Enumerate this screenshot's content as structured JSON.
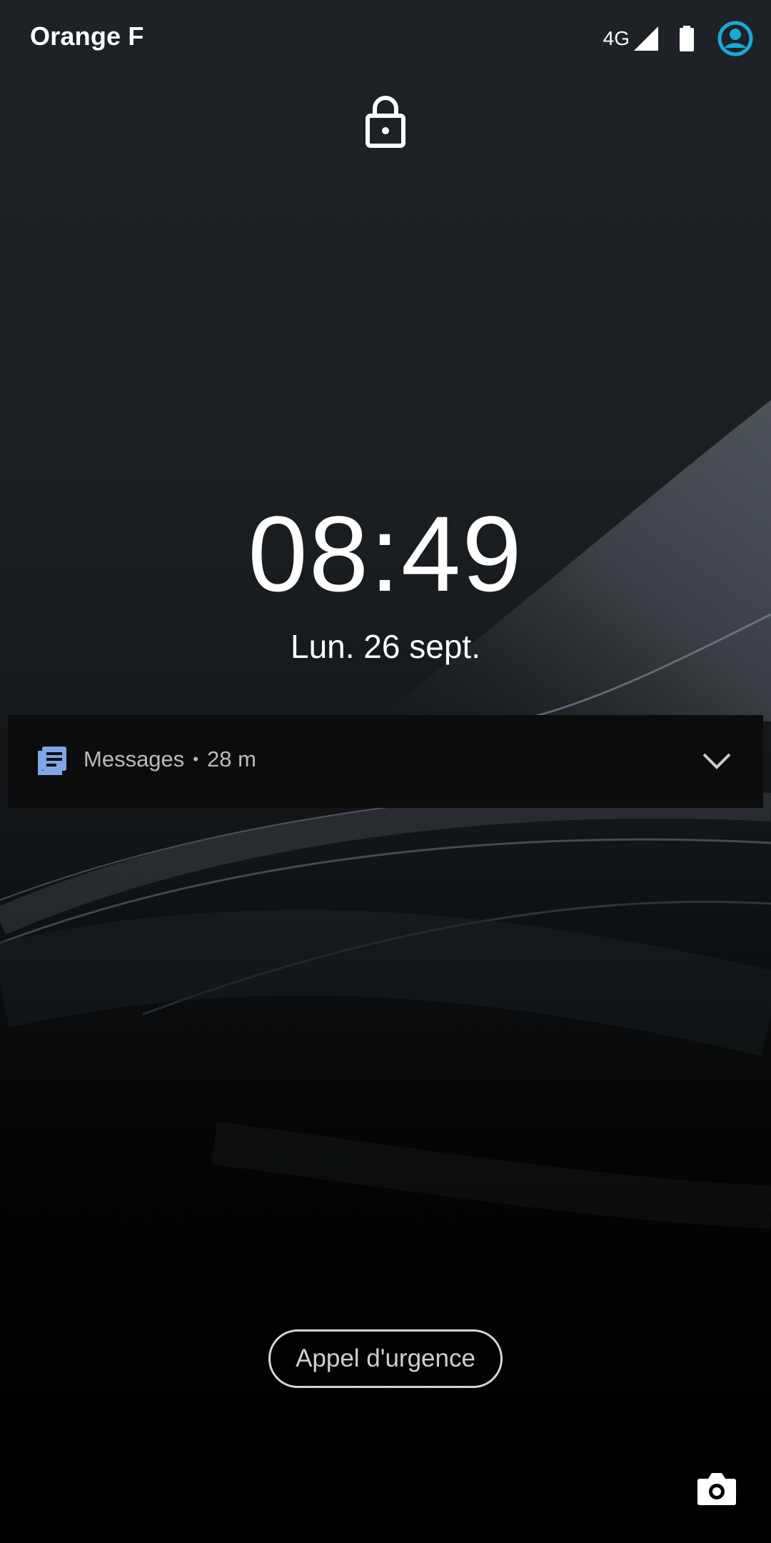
{
  "status_bar": {
    "carrier": "Orange F",
    "network_type": "4G",
    "signal_icon": "cell-signal-icon",
    "battery_icon": "battery-icon",
    "account_icon": "account-circle-icon",
    "accent_color": "#19a9d6"
  },
  "lockscreen": {
    "lock_icon": "lock-icon",
    "time": "08:49",
    "date": "Lun. 26 sept."
  },
  "notification": {
    "app_icon": "messages-icon",
    "app_name": "Messages",
    "separator": "•",
    "age": "28 m",
    "expand_icon": "chevron-down-icon",
    "icon_color": "#7ea6e8"
  },
  "actions": {
    "emergency_label": "Appel d'urgence",
    "camera_icon": "camera-icon"
  }
}
